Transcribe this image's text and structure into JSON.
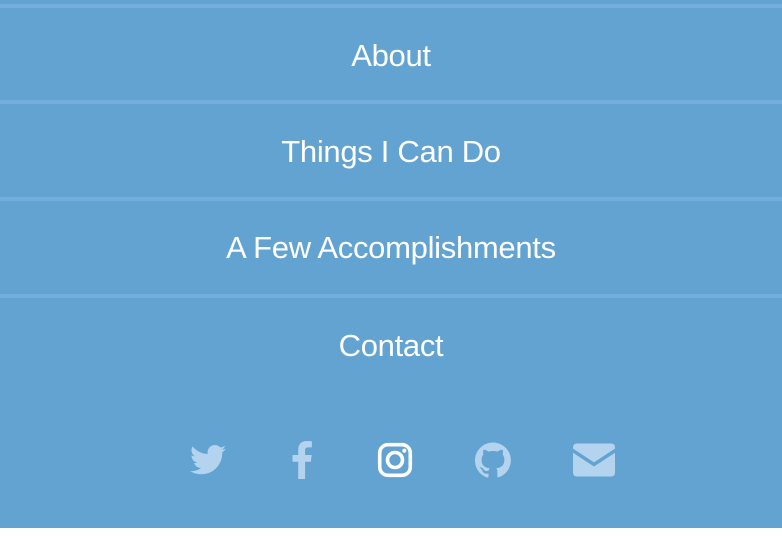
{
  "nav": {
    "items": [
      {
        "label": "About"
      },
      {
        "label": "Things I Can Do"
      },
      {
        "label": "A Few Accomplishments"
      },
      {
        "label": "Contact"
      }
    ]
  },
  "social": {
    "icons": [
      "twitter-icon",
      "facebook-icon",
      "instagram-icon",
      "github-icon",
      "envelope-icon"
    ]
  },
  "colors": {
    "panel_background": "#62a3d1",
    "divider": "#74aede",
    "nav_text": "#ffffff",
    "icon_muted": "#b3d3ee",
    "icon_active": "#ffffff",
    "page_background": "#ffffff"
  }
}
